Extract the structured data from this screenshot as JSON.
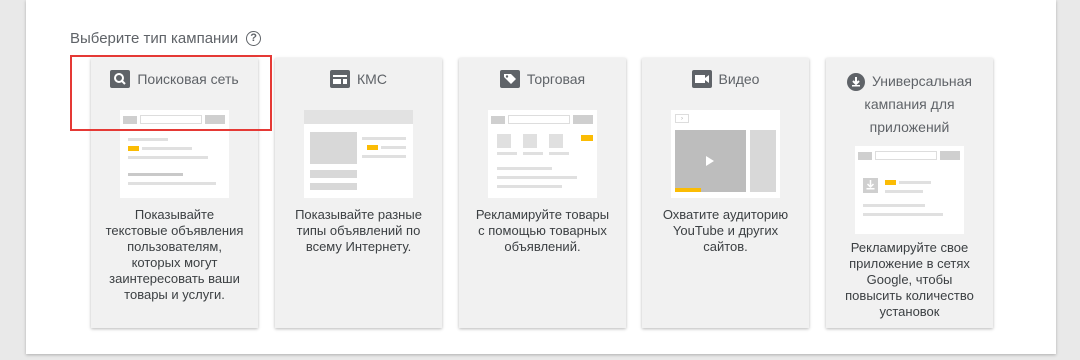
{
  "heading": "Выберите тип кампании",
  "help_icon": "?",
  "cards": [
    {
      "name": "search",
      "title": "Поисковая сеть",
      "icon": "search-icon",
      "desc": "Показывайте текстовые объявления пользователям, которых могут заинтересовать ваши товары и услуги."
    },
    {
      "name": "display",
      "title": "КМС",
      "icon": "display-icon",
      "desc": "Показывайте разные типы объявлений по всему Интернету."
    },
    {
      "name": "shopping",
      "title": "Торговая",
      "icon": "tag-icon",
      "desc": "Рекламируйте товары с помощью товарных объявлений."
    },
    {
      "name": "video",
      "title": "Видео",
      "icon": "video-camera-icon",
      "desc": "Охватите аудиторию YouTube и других сайтов."
    },
    {
      "name": "app",
      "title_lines": [
        "Универсальная",
        "кампания для",
        "приложений"
      ],
      "icon": "download-icon",
      "desc": "Рекламируйте свое приложение в сетях Google, чтобы повысить количество установок"
    }
  ],
  "colors": {
    "accent": "#fbbc04",
    "highlight": "#e53935"
  }
}
